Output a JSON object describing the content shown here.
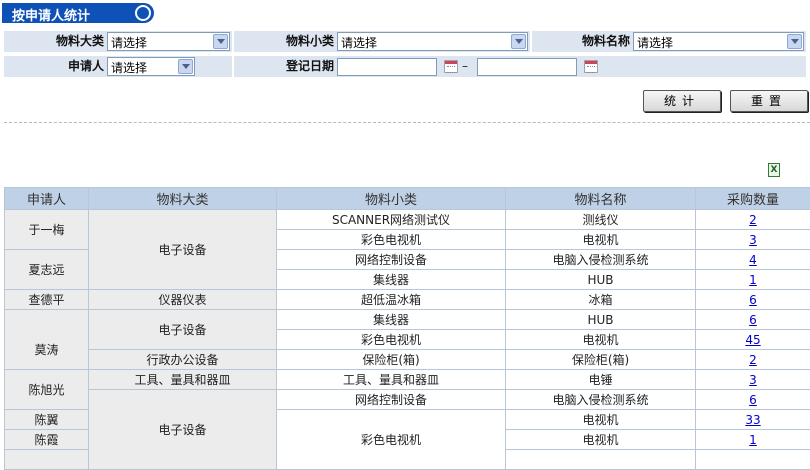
{
  "title": "按申请人统计",
  "filters": {
    "major_label": "物料大类",
    "major_value": "请选择",
    "minor_label": "物料小类",
    "minor_value": "请选择",
    "name_label": "物料名称",
    "name_value": "请选择",
    "applicant_label": "申请人",
    "applicant_value": "请选择",
    "date_label": "登记日期",
    "date_sep": "–"
  },
  "buttons": {
    "stat": "统计",
    "reset": "重置"
  },
  "table": {
    "headers": [
      "申请人",
      "物料大类",
      "物料小类",
      "物料名称",
      "采购数量"
    ],
    "rows": [
      {
        "applicant": "于一梅",
        "major": "电子设备",
        "minor": "SCANNER网络测试仪",
        "name": "测线仪",
        "qty": "2"
      },
      {
        "minor": "彩色电视机",
        "name": "电视机",
        "qty": "3"
      },
      {
        "applicant": "夏志远",
        "minor": "网络控制设备",
        "name": "电脑入侵检测系统",
        "qty": "4"
      },
      {
        "minor": "集线器",
        "name": "HUB",
        "qty": "1"
      },
      {
        "applicant": "查德平",
        "major": "仪器仪表",
        "minor": "超低温冰箱",
        "name": "冰箱",
        "qty": "6"
      },
      {
        "major": "电子设备",
        "minor": "集线器",
        "name": "HUB",
        "qty": "6"
      },
      {
        "applicant": "莫涛",
        "minor": "彩色电视机",
        "name": "电视机",
        "qty": "45"
      },
      {
        "major": "行政办公设备",
        "minor": "保险柜(箱)",
        "name": "保险柜(箱)",
        "qty": "2"
      },
      {
        "applicant": "陈旭光",
        "major": "工具、量具和器皿",
        "minor": "工具、量具和器皿",
        "name": "电锤",
        "qty": "3"
      },
      {
        "major": "电子设备",
        "minor": "网络控制设备",
        "name": "电脑入侵检测系统",
        "qty": "6"
      },
      {
        "applicant": "陈翼",
        "minor": "彩色电视机",
        "name": "电视机",
        "qty": "33"
      },
      {
        "applicant": "陈霞",
        "name": "电视机",
        "qty": "1"
      }
    ]
  }
}
